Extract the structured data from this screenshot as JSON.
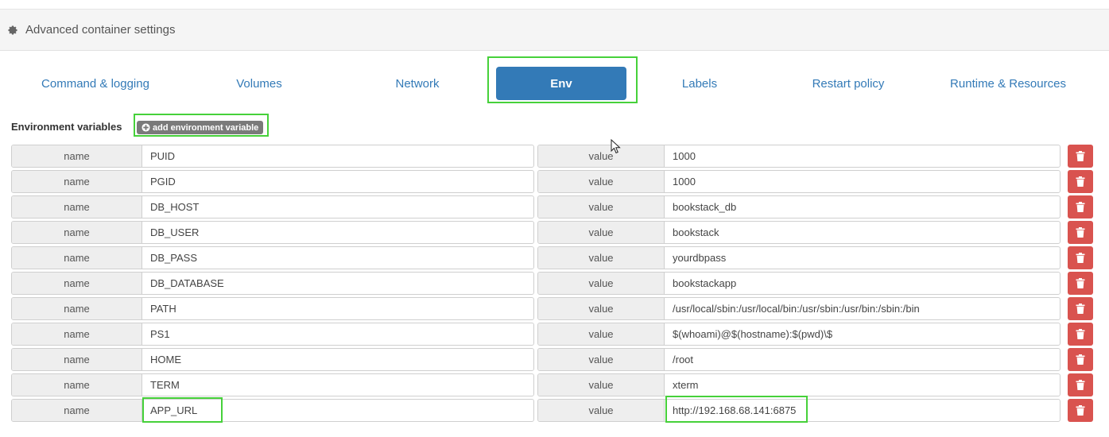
{
  "section": {
    "title": "Advanced container settings",
    "icon": "gear-icon"
  },
  "tabs": [
    {
      "label": "Command & logging",
      "active": false
    },
    {
      "label": "Volumes",
      "active": false
    },
    {
      "label": "Network",
      "active": false
    },
    {
      "label": "Env",
      "active": true
    },
    {
      "label": "Labels",
      "active": false
    },
    {
      "label": "Restart policy",
      "active": false
    },
    {
      "label": "Runtime & Resources",
      "active": false
    }
  ],
  "env": {
    "label": "Environment variables",
    "add_button": "add environment variable",
    "name_addon": "name",
    "value_addon": "value",
    "variables": [
      {
        "name": "PUID",
        "value": "1000"
      },
      {
        "name": "PGID",
        "value": "1000"
      },
      {
        "name": "DB_HOST",
        "value": "bookstack_db"
      },
      {
        "name": "DB_USER",
        "value": "bookstack"
      },
      {
        "name": "DB_PASS",
        "value": "yourdbpass"
      },
      {
        "name": "DB_DATABASE",
        "value": "bookstackapp"
      },
      {
        "name": "PATH",
        "value": "/usr/local/sbin:/usr/local/bin:/usr/sbin:/usr/bin:/sbin:/bin"
      },
      {
        "name": "PS1",
        "value": "$(whoami)@$(hostname):$(pwd)\\$"
      },
      {
        "name": "HOME",
        "value": "/root"
      },
      {
        "name": "TERM",
        "value": "xterm"
      },
      {
        "name": "APP_URL",
        "value": "http://192.168.68.141:6875"
      }
    ]
  },
  "colors": {
    "primary": "#337ab7",
    "danger": "#d9534f",
    "highlight": "#46d13a",
    "add_button": "#7a7a7a"
  }
}
